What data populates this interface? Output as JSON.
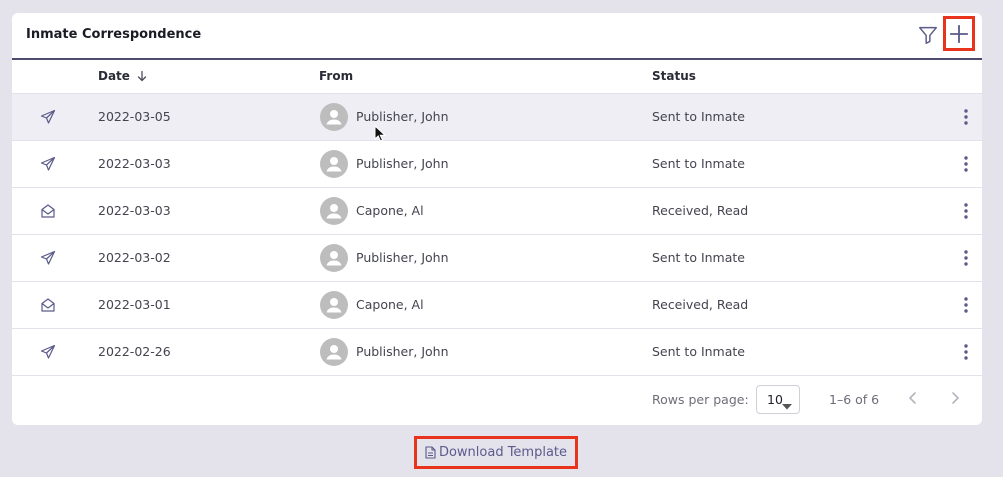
{
  "card": {
    "title": "Inmate Correspondence"
  },
  "table": {
    "columns": {
      "date": "Date",
      "from": "From",
      "status": "Status"
    },
    "rows": [
      {
        "type": "sent-icon",
        "date": "2022-03-05",
        "from": "Publisher, John",
        "status": "Sent to Inmate"
      },
      {
        "type": "sent-icon",
        "date": "2022-03-03",
        "from": "Publisher, John",
        "status": "Sent to Inmate"
      },
      {
        "type": "envelope-open-icon",
        "date": "2022-03-03",
        "from": "Capone, Al",
        "status": "Received, Read"
      },
      {
        "type": "sent-icon",
        "date": "2022-03-02",
        "from": "Publisher, John",
        "status": "Sent to Inmate"
      },
      {
        "type": "envelope-open-icon",
        "date": "2022-03-01",
        "from": "Capone, Al",
        "status": "Received, Read"
      },
      {
        "type": "sent-icon",
        "date": "2022-02-26",
        "from": "Publisher, John",
        "status": "Sent to Inmate"
      }
    ]
  },
  "pagination": {
    "rows_per_page_label": "Rows per page:",
    "rows_per_page_value": "10",
    "range": "1–6 of 6"
  },
  "download": {
    "label": "Download Template"
  },
  "colors": {
    "accent": "#4d4b6d",
    "highlight_border": "#e8341c",
    "link": "#5b5a8a"
  }
}
